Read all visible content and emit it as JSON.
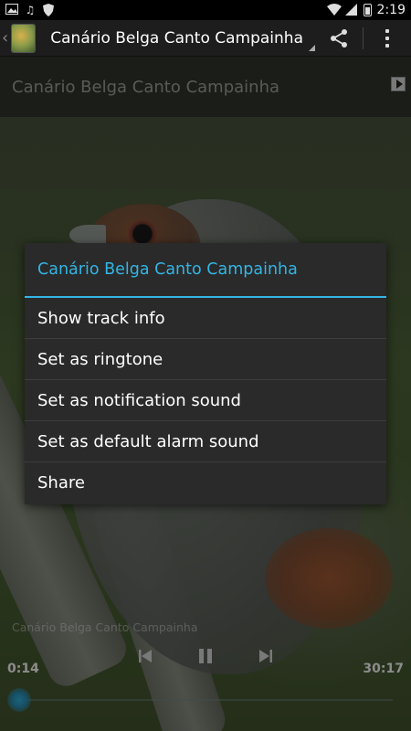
{
  "status_bar": {
    "time": "2:19",
    "left_icons": [
      "image-icon",
      "music-note-icon",
      "shield-icon"
    ],
    "right_icons": [
      "wifi-icon",
      "signal-icon",
      "battery-icon"
    ]
  },
  "action_bar": {
    "title": "Canário Belga Canto Campainha",
    "actions": [
      "share-icon",
      "overflow-menu-icon"
    ]
  },
  "track_header": {
    "title": "Canário Belga Canto Campainha"
  },
  "dialog": {
    "title": "Canário Belga Canto Campainha",
    "items": [
      {
        "label": "Show track info"
      },
      {
        "label": "Set as ringtone"
      },
      {
        "label": "Set as notification sound"
      },
      {
        "label": "Set as default alarm sound"
      },
      {
        "label": "Share"
      }
    ]
  },
  "player": {
    "title": "Canário Belga Canto Campainha",
    "elapsed": "0:14",
    "duration": "30:17",
    "progress_fraction": 0.008
  },
  "colors": {
    "accent": "#33b5e5",
    "dialog_bg": "#2a2a2a",
    "action_bar_bg": "#1d1d1d"
  }
}
